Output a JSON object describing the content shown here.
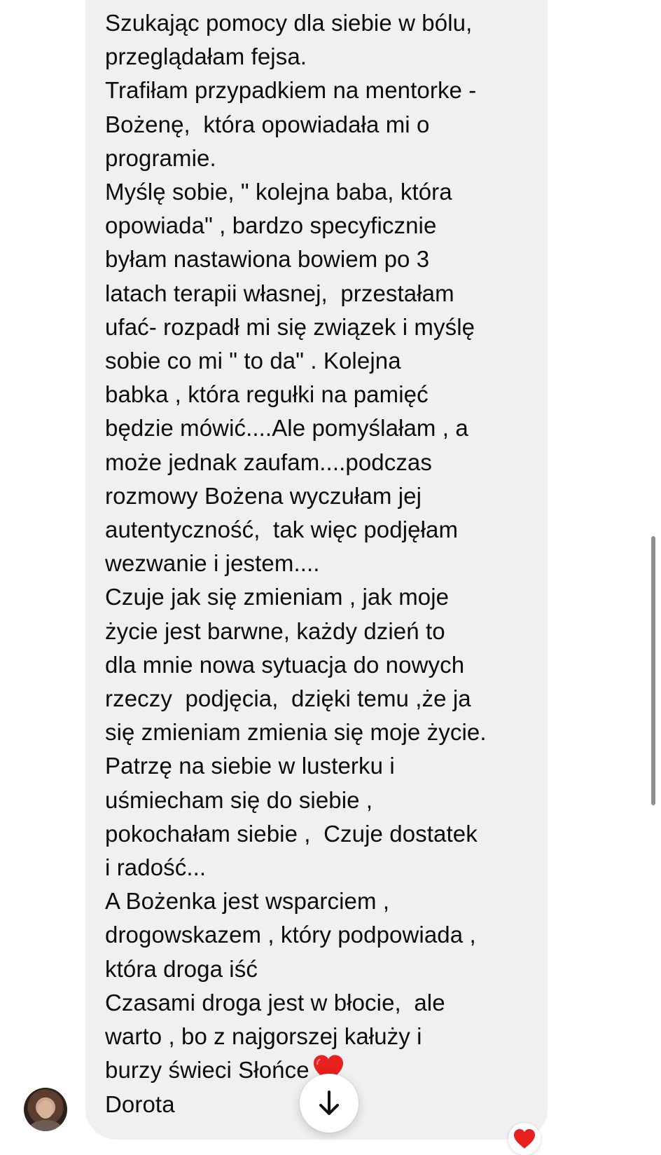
{
  "message": {
    "lines": [
      "Szukając pomocy dla siebie w bólu,",
      "przeglądałam fejsa.",
      "Trafiłam przypadkiem na mentorke -",
      "Bożenę,  która opowiadała mi o",
      "programie.",
      "Myślę sobie, \" kolejna baba, która",
      "opowiada\" , bardzo specyficznie",
      "byłam nastawiona bowiem po 3",
      "latach terapii własnej,  przestałam",
      "ufać- rozpadł mi się związek i myślę",
      "sobie co mi \" to da\" . Kolejna",
      "babka , która regułki na pamięć",
      "będzie mówić....Ale pomyślałam , a",
      "może jednak zaufam....podczas",
      "rozmowy Bożena wyczułam jej",
      "autentyczność,  tak więc podjęłam",
      "wezwanie i jestem....",
      "Czuje jak się zmieniam , jak moje",
      "życie jest barwne, każdy dzień to",
      "dla mnie nowa sytuacja do nowych",
      "rzeczy  podjęcia,  dzięki temu ,że ja",
      "się zmieniam zmienia się moje życie.",
      "Patrzę na siebie w lusterku i",
      "uśmiecham się do siebie ,",
      "pokochałam siebie ,  Czuje dostatek",
      "i radość...",
      "A Bożenka jest wsparciem ,",
      "drogowskazem , który podpowiada ,",
      "która droga iść",
      "Czasami droga jest w błocie,  ale",
      "warto , bo z najgorszej kałuży i"
    ],
    "last_line": "burzy świeci Słońce",
    "signature": "Dorota",
    "emoji": "heart-emoji"
  },
  "icons": {
    "scroll_down": "arrow-down-icon",
    "reaction": "heart-icon"
  },
  "colors": {
    "bubble": "#f0f0f2",
    "text": "#0c0c0c",
    "heart": "#e8201f",
    "scrollbar": "#8e8e93"
  }
}
